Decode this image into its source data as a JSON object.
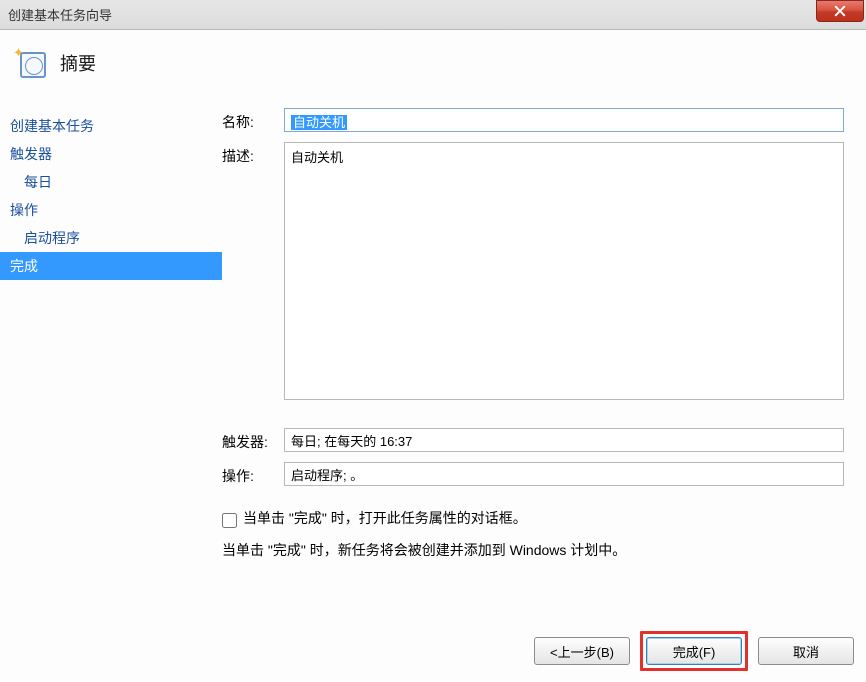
{
  "window": {
    "title": "创建基本任务向导"
  },
  "header": {
    "title": "摘要"
  },
  "sidebar": {
    "items": [
      {
        "label": "创建基本任务",
        "indent": false,
        "selected": false
      },
      {
        "label": "触发器",
        "indent": false,
        "selected": false
      },
      {
        "label": "每日",
        "indent": true,
        "selected": false
      },
      {
        "label": "操作",
        "indent": false,
        "selected": false
      },
      {
        "label": "启动程序",
        "indent": true,
        "selected": false
      },
      {
        "label": "完成",
        "indent": false,
        "selected": true
      }
    ]
  },
  "form": {
    "name_label": "名称:",
    "name_value": "自动关机",
    "desc_label": "描述:",
    "desc_value": "自动关机",
    "trigger_label": "触发器:",
    "trigger_value": "每日; 在每天的 16:37",
    "action_label": "操作:",
    "action_value": "启动程序; 。",
    "checkbox_label": "当单击 \"完成\" 时，打开此任务属性的对话框。",
    "info_text": "当单击 \"完成\" 时，新任务将会被创建并添加到 Windows 计划中。"
  },
  "footer": {
    "back": "<上一步(B)",
    "finish": "完成(F)",
    "cancel": "取消"
  }
}
